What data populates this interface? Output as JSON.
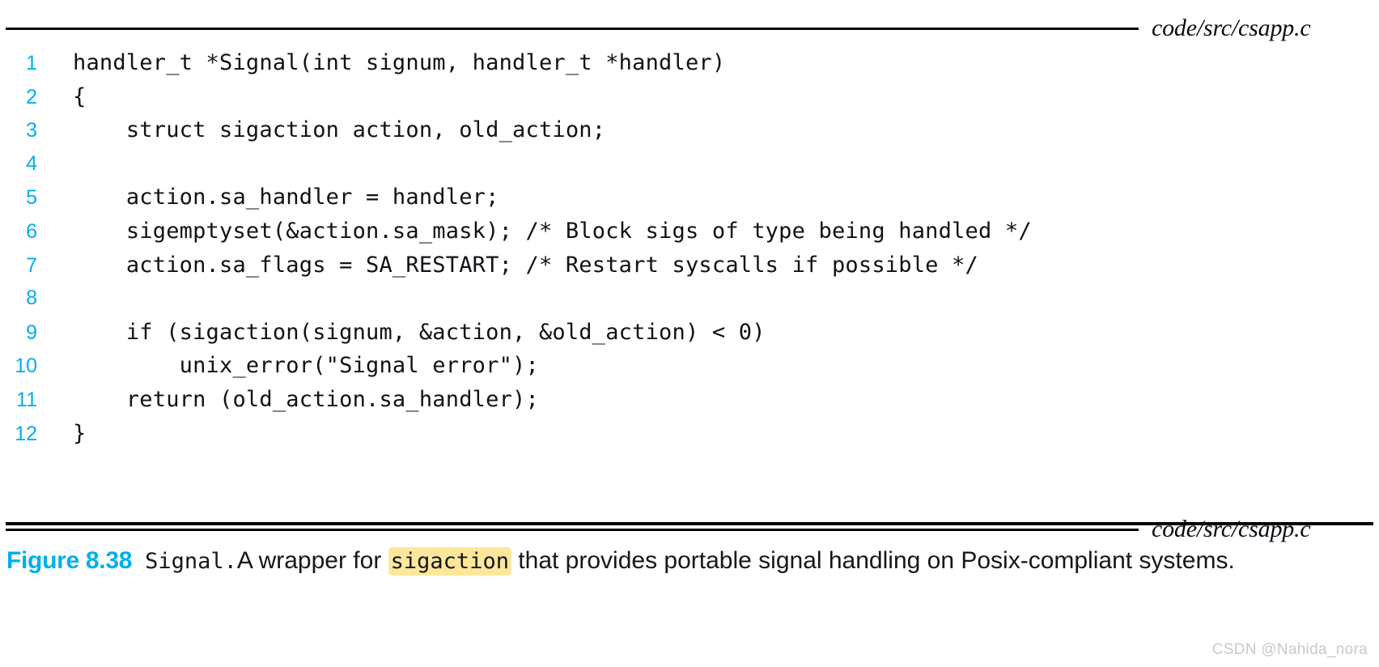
{
  "figure": {
    "top_file_label": "code/src/csapp.c",
    "bottom_file_label": "code/src/csapp.c",
    "code_language": "c",
    "code_lines": [
      {
        "number": "1",
        "text": "handler_t *Signal(int signum, handler_t *handler)"
      },
      {
        "number": "2",
        "text": "{"
      },
      {
        "number": "3",
        "text": "    struct sigaction action, old_action;"
      },
      {
        "number": "4",
        "text": ""
      },
      {
        "number": "5",
        "text": "    action.sa_handler = handler;"
      },
      {
        "number": "6",
        "text": "    sigemptyset(&action.sa_mask); /* Block sigs of type being handled */"
      },
      {
        "number": "7",
        "text": "    action.sa_flags = SA_RESTART; /* Restart syscalls if possible */"
      },
      {
        "number": "8",
        "text": ""
      },
      {
        "number": "9",
        "text": "    if (sigaction(signum, &action, &old_action) < 0)"
      },
      {
        "number": "10",
        "text": "        unix_error(\"Signal error\");"
      },
      {
        "number": "11",
        "text": "    return (old_action.sa_handler);"
      },
      {
        "number": "12",
        "text": "}"
      }
    ],
    "caption": {
      "label": "Figure 8.38",
      "function_name": "Signal.",
      "text_before_code": "A wrapper for ",
      "highlighted_code": "sigaction",
      "text_after_code": " that provides portable signal handling on Posix-compliant systems."
    }
  },
  "watermark": {
    "text": "CSDN @Nahida_nora"
  },
  "colors": {
    "accent_blue": "#00aeef",
    "highlight_yellow": "#fde79a",
    "rule_black": "#000000",
    "text_dark": "#16161c",
    "watermark_gray": "#c9c9cd"
  }
}
